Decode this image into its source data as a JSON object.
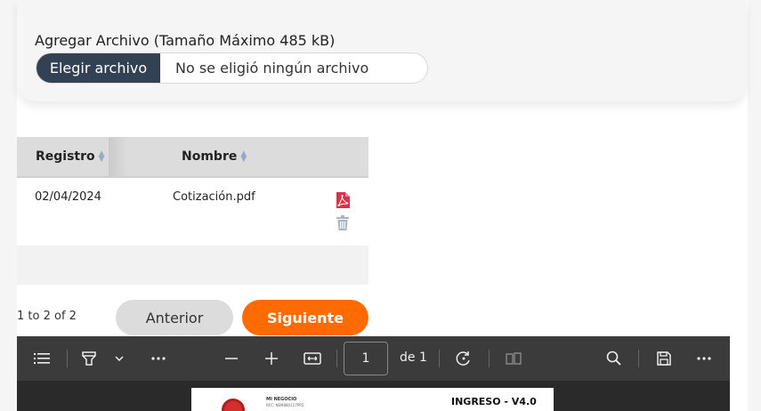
{
  "upload": {
    "label": "Agregar Archivo (Tamaño Máximo 485 kB)",
    "button_label": "Elegir archivo",
    "status": "No se eligió ningún archivo"
  },
  "table": {
    "columns": [
      "Registro",
      "Nombre"
    ],
    "rows": [
      {
        "registro": "02/04/2024",
        "nombre": "Cotización.pdf"
      }
    ]
  },
  "pagination": {
    "summary": "1 to 2 of 2",
    "prev_label": "Anterior",
    "next_label": "Siguiente"
  },
  "viewer": {
    "page_number": "1",
    "page_of": "de 1",
    "doc_header_small": "MI NEGOCIO",
    "doc_header_small2": "RFC: NEM880127PR5",
    "doc_title": "INGRESO - V4.0"
  },
  "colors": {
    "primary_orange": "#ff6b00",
    "file_button": "#334155",
    "toolbar": "#3b3b3b"
  }
}
